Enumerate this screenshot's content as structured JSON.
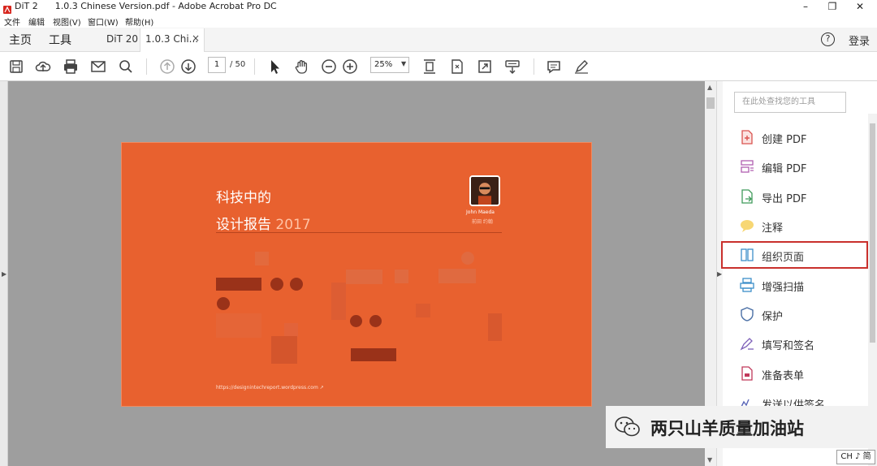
{
  "window": {
    "app_short": "DiT 2",
    "title": "1.0.3 Chinese Version.pdf - Adobe Acrobat Pro DC",
    "controls": [
      "–",
      "❐",
      "✕"
    ]
  },
  "menu": [
    "文件",
    "编辑",
    "视图(V)",
    "窗口(W)",
    "帮助(H)"
  ],
  "tabs": {
    "home": "主页",
    "tools": "工具",
    "docs": [
      "DiT 20",
      "1.0.3 Chi..."
    ],
    "close": "×",
    "help_icon": "?",
    "login": "登录"
  },
  "toolbar": {
    "page_current": "1",
    "page_total": "/ 50",
    "zoom": "25%",
    "zoom_arrow": "▼"
  },
  "cover": {
    "title_line1": "科技中的",
    "title_line2": "设计报告",
    "year": "2017",
    "author_name": "John Maeda",
    "author_sub": "前田 约翰",
    "url": "https://designintechreport.wordpress.com"
  },
  "tools_panel": {
    "search_placeholder": "在此处查找您的工具",
    "items": [
      {
        "label": "创建 PDF",
        "icon": "create-pdf-icon"
      },
      {
        "label": "编辑 PDF",
        "icon": "edit-pdf-icon"
      },
      {
        "label": "导出 PDF",
        "icon": "export-pdf-icon"
      },
      {
        "label": "注释",
        "icon": "comment-icon"
      },
      {
        "label": "组织页面",
        "icon": "organize-pages-icon"
      },
      {
        "label": "增强扫描",
        "icon": "enhance-scan-icon"
      },
      {
        "label": "保护",
        "icon": "protect-icon"
      },
      {
        "label": "填写和签名",
        "icon": "fill-sign-icon"
      },
      {
        "label": "准备表单",
        "icon": "prepare-form-icon"
      },
      {
        "label": "发送以供签名",
        "icon": "send-for-signature-icon"
      }
    ],
    "highlighted_index": 4
  },
  "watermark": {
    "text": "两只山羊质量加油站"
  },
  "ime": {
    "label": "CH ♪ 简"
  },
  "colors": {
    "cover_orange": "#e8612f",
    "doc_background": "#9e9e9e",
    "highlight_red": "#c9302c"
  }
}
